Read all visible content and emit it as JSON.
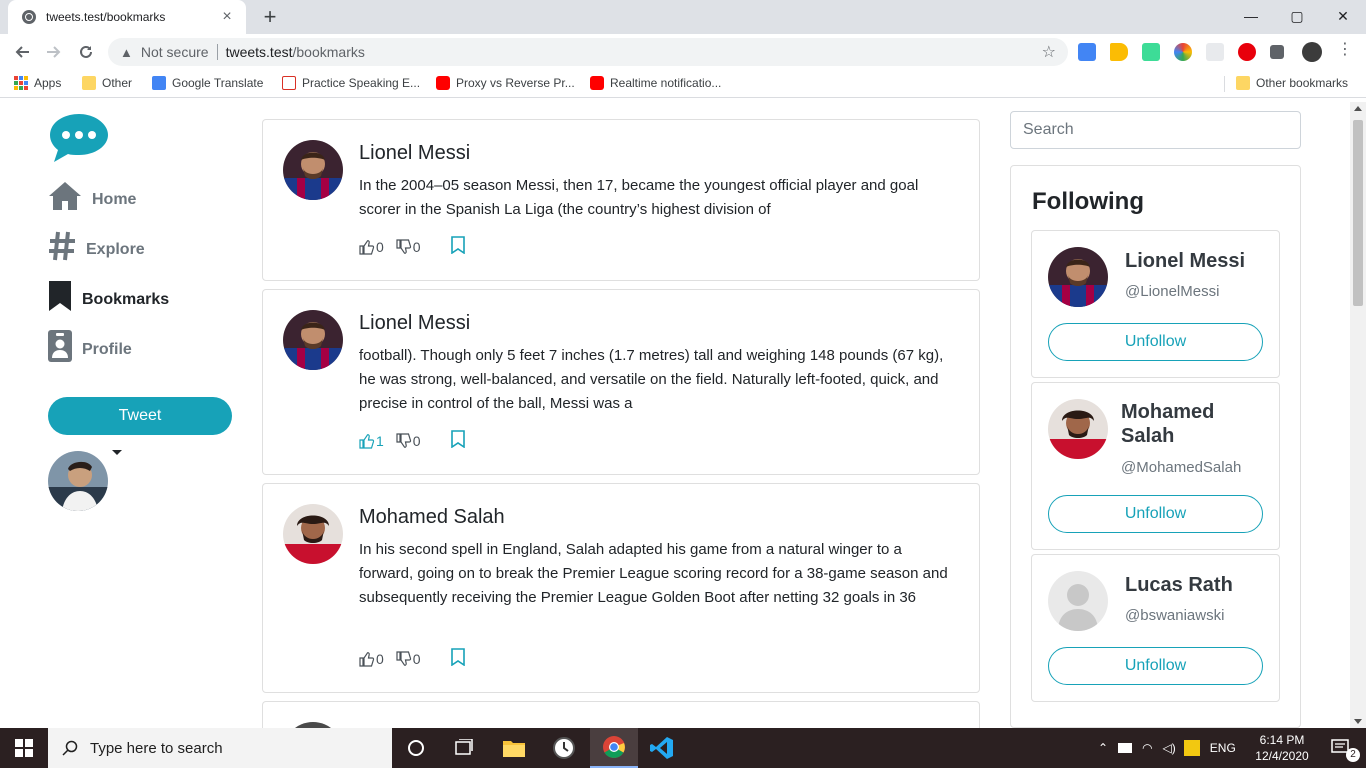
{
  "browser": {
    "tab_title": "tweets.test/bookmarks",
    "tab_close": "×",
    "new_tab": "+",
    "window_controls": {
      "minimize": "—",
      "maximize": "▢",
      "close": "✕"
    },
    "security_label": "Not secure",
    "url_host": "tweets.test",
    "url_path": "/bookmarks",
    "bookmarks": [
      {
        "label": "Apps",
        "icon": "apps-grid-icon"
      },
      {
        "label": "Other",
        "icon": "folder-icon"
      },
      {
        "label": "Google Translate",
        "icon": "google-translate-icon"
      },
      {
        "label": "Practice Speaking E...",
        "icon": "practice-speaking-icon"
      },
      {
        "label": "Proxy vs Reverse Pr...",
        "icon": "youtube-icon"
      },
      {
        "label": "Realtime notificatio...",
        "icon": "youtube-icon"
      }
    ],
    "other_bookmarks": "Other bookmarks"
  },
  "sidebar": {
    "nav": [
      {
        "label": "Home",
        "icon": "home-icon"
      },
      {
        "label": "Explore",
        "icon": "hashtag-icon"
      },
      {
        "label": "Bookmarks",
        "icon": "bookmark-icon"
      },
      {
        "label": "Profile",
        "icon": "profile-icon"
      }
    ],
    "tweet_button": "Tweet"
  },
  "tweets": [
    {
      "author": "Lionel Messi",
      "avatar": "messi",
      "body": "In the 2004–05 season Messi, then 17, became the youngest official player and goal scorer in the Spanish La Liga (the country’s highest division of",
      "likes": "0",
      "dislikes": "0",
      "liked": false
    },
    {
      "author": "Lionel Messi",
      "avatar": "messi",
      "body": "football). Though only 5 feet 7 inches (1.7 metres) tall and weighing 148 pounds (67 kg), he was strong, well-balanced, and versatile on the field. Naturally left-footed, quick, and precise in control of the ball, Messi was a",
      "likes": "1",
      "dislikes": "0",
      "liked": true
    },
    {
      "author": "Mohamed Salah",
      "avatar": "salah",
      "body": "In his second spell in England, Salah adapted his game from a natural winger to a forward, going on to break the Premier League scoring record for a 38-game season and subsequently receiving the Premier League Golden Boot after netting 32 goals in 36",
      "likes": "0",
      "dislikes": "0",
      "liked": false
    }
  ],
  "search": {
    "placeholder": "Search"
  },
  "following": {
    "title": "Following",
    "users": [
      {
        "name": "Lionel Messi",
        "handle": "@LionelMessi",
        "button": "Unfollow",
        "avatar": "messi"
      },
      {
        "name": "Mohamed Salah",
        "handle": "@MohamedSalah",
        "button": "Unfollow",
        "avatar": "salah"
      },
      {
        "name": "Lucas Rath",
        "handle": "@bswaniawski",
        "button": "Unfollow",
        "avatar": "default"
      }
    ]
  },
  "taskbar": {
    "search_placeholder": "Type here to search",
    "language": "ENG",
    "time": "6:14 PM",
    "date": "12/4/2020",
    "notifications": "2"
  },
  "colors": {
    "accent": "#17a2b8",
    "taskbar": "#2b2021"
  }
}
